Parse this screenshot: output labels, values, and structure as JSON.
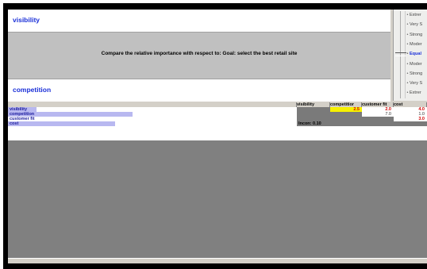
{
  "comparison": {
    "top_element": "visibility",
    "bottom_element": "competition",
    "question": "Compare the relative importance  with respect to: Goal: select the best retail site"
  },
  "verbal_scale": {
    "items": [
      {
        "label": "Extrer",
        "active": false
      },
      {
        "label": "Very S",
        "active": false
      },
      {
        "label": "Strong",
        "active": false
      },
      {
        "label": "Moder",
        "active": false
      },
      {
        "label": "Equal",
        "active": true
      },
      {
        "label": "Moder",
        "active": false
      },
      {
        "label": "Strong",
        "active": false
      },
      {
        "label": "Very S",
        "active": false
      },
      {
        "label": "Extrer",
        "active": false
      }
    ]
  },
  "matrix": {
    "headers": [
      "visibility",
      "competitior",
      "customer fit",
      "cost"
    ],
    "rows": [
      {
        "label": "visibility",
        "bar": 0.1,
        "cells": [
          "",
          "2.5",
          "2.0",
          "4.0"
        ]
      },
      {
        "label": "competition",
        "bar": 0.43,
        "cells": [
          "",
          "",
          "7.0",
          "1.0"
        ]
      },
      {
        "label": "customer fit",
        "bar": 0.0,
        "cells": [
          "",
          "",
          "",
          "3.0"
        ]
      },
      {
        "label": "cost",
        "bar": 0.37,
        "cells": [
          "Incon: 0.10",
          "",
          "",
          ""
        ]
      }
    ]
  },
  "colors": {
    "accent": "#1a2fd8",
    "bar": "#b8b8f0",
    "highlight": "#f6f000",
    "value_red": "#d40000"
  }
}
